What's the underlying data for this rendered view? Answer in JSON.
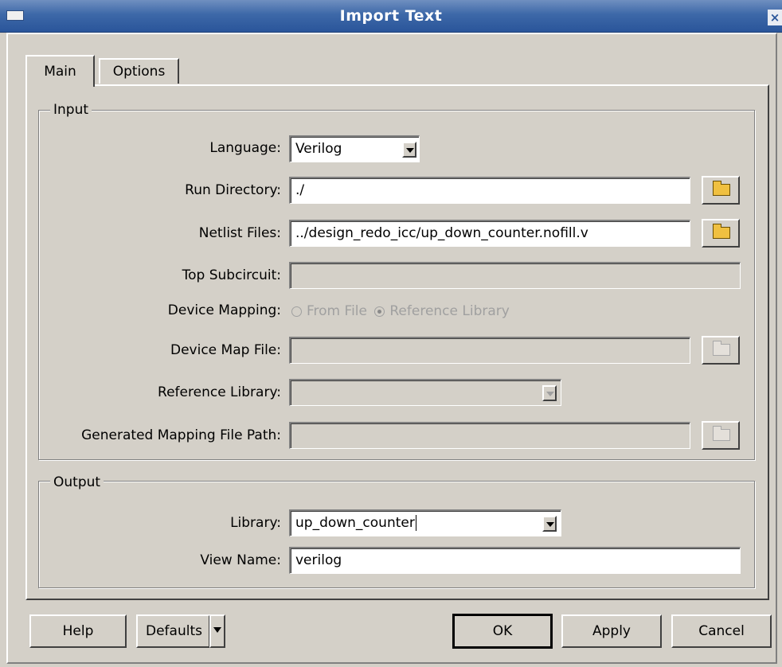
{
  "window": {
    "title": "Import Text",
    "close_glyph": "×"
  },
  "tabs": [
    {
      "label": "Main"
    },
    {
      "label": "Options"
    }
  ],
  "input_group": {
    "legend": "Input",
    "language": {
      "label": "Language:",
      "value": "Verilog"
    },
    "run_directory": {
      "label": "Run Directory:",
      "value": "./"
    },
    "netlist_files": {
      "label": "Netlist Files:",
      "value": "../design_redo_icc/up_down_counter.nofill.v"
    },
    "top_subcircuit": {
      "label": "Top Subcircuit:",
      "value": ""
    },
    "device_mapping": {
      "label": "Device Mapping:",
      "options": [
        {
          "label": "From File",
          "selected": false
        },
        {
          "label": "Reference Library",
          "selected": true
        }
      ]
    },
    "device_map_file": {
      "label": "Device Map File:",
      "value": ""
    },
    "reference_library": {
      "label": "Reference Library:",
      "value": ""
    },
    "generated_mapping_file_path": {
      "label": "Generated Mapping File Path:",
      "value": ""
    }
  },
  "output_group": {
    "legend": "Output",
    "library": {
      "label": "Library:",
      "value": "up_down_counter"
    },
    "view_name": {
      "label": "View Name:",
      "value": "verilog"
    }
  },
  "buttons": {
    "help": "Help",
    "defaults": "Defaults",
    "ok": "OK",
    "apply": "Apply",
    "cancel": "Cancel"
  },
  "icons": {
    "browse": "folder-icon",
    "dropdown": "chevron-down-icon"
  }
}
